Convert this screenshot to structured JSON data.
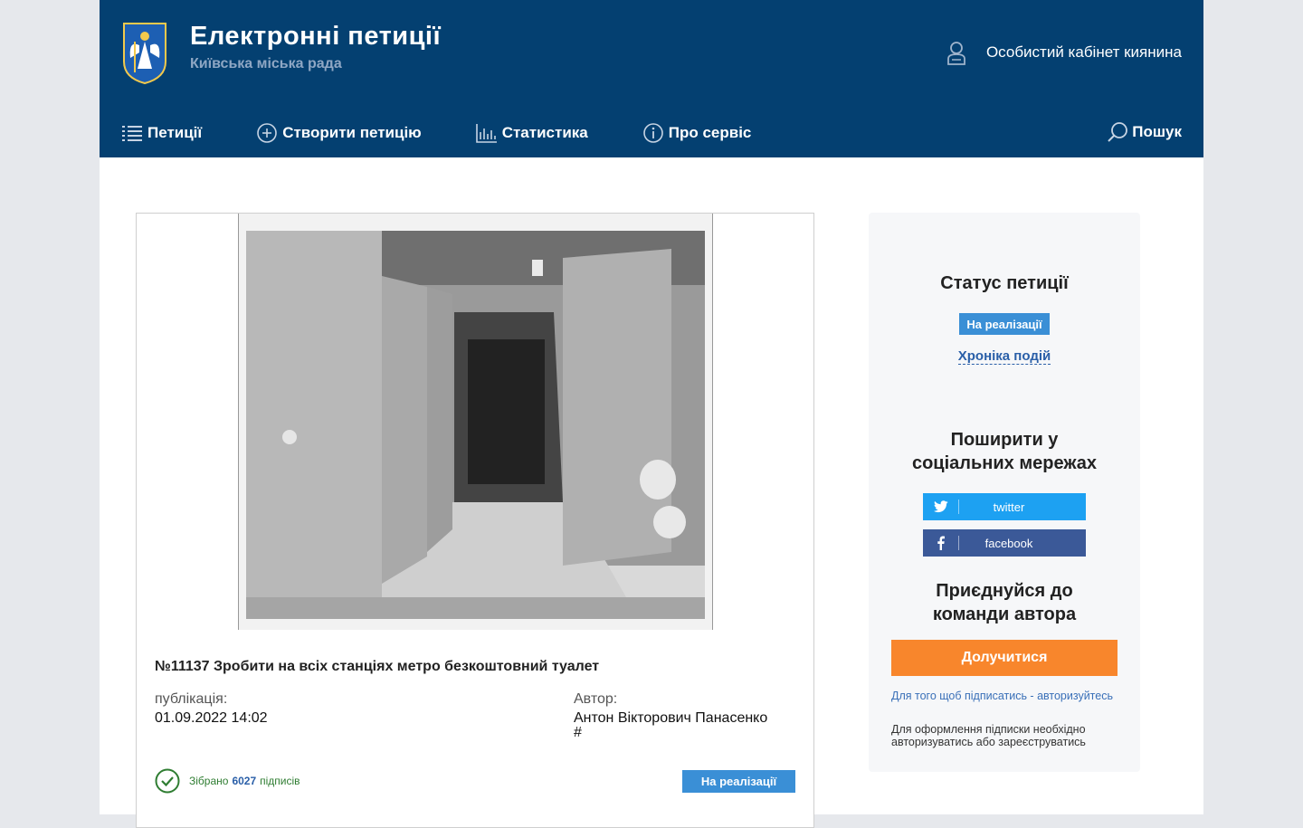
{
  "header": {
    "title": "Електронні петиції",
    "subtitle": "Київська міська рада",
    "cabinet_label": "Особистий кабінет киянина",
    "nav": [
      {
        "label": "Петиції",
        "icon": "list-icon"
      },
      {
        "label": "Створити петицію",
        "icon": "plus-circle-icon"
      },
      {
        "label": "Статистика",
        "icon": "bar-chart-icon"
      },
      {
        "label": "Про сервіс",
        "icon": "info-icon"
      }
    ],
    "search_label": "Пошук"
  },
  "petition": {
    "title": "№11137 Зробити на всіх станціях метро безкоштовний туалет",
    "published_label": "публікація:",
    "published_value": "01.09.2022 14:02",
    "author_label": "Автор:",
    "author_value": "Антон Вікторович Панасенко",
    "author_extra": "#",
    "collected_prefix": "Зібрано",
    "collected_count": "6027",
    "collected_suffix": "підписів",
    "status": "На реалізації"
  },
  "sidebar": {
    "status_heading": "Статус петиції",
    "status_badge": "На реалізації",
    "chronicle_link": "Хроніка подій",
    "share_heading_line1": "Поширити у",
    "share_heading_line2": "соціальних мережах",
    "twitter_label": "twitter",
    "facebook_label": "facebook",
    "join_heading_line1": "Приєднуйся до",
    "join_heading_line2": "команди автора",
    "join_button": "Долучитися",
    "note_auth": "Для того щоб підписатись - авторизуйтесь",
    "note_register": "Для оформлення підписки необхідно авторизуватись або зареєструватись"
  },
  "colors": {
    "header_bg": "#044071",
    "accent_blue": "#3a8fd6",
    "twitter": "#1da1f2",
    "facebook": "#3b5998",
    "join_orange": "#f8862c"
  }
}
